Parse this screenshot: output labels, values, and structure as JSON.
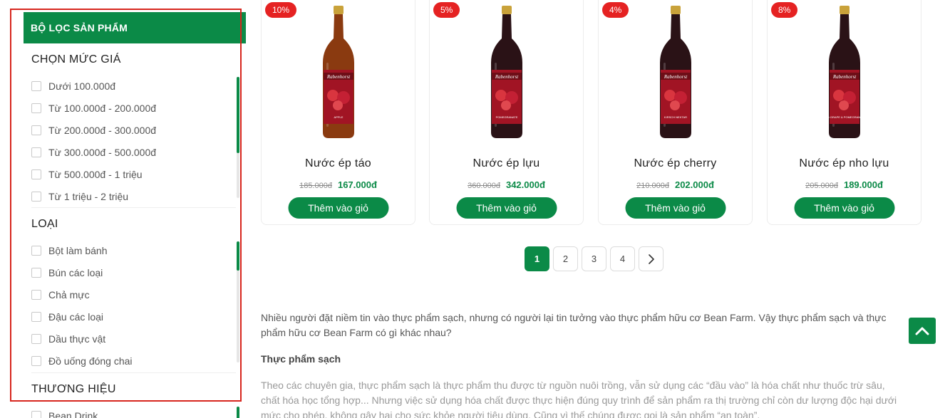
{
  "sidebar": {
    "header": "BỘ LỌC SẢN PHẨM",
    "price_group": {
      "title": "CHỌN MỨC GIÁ",
      "items": [
        "Dưới 100.000đ",
        "Từ 100.000đ - 200.000đ",
        "Từ 200.000đ - 300.000đ",
        "Từ 300.000đ - 500.000đ",
        "Từ 500.000đ - 1 triệu",
        "Từ 1 triệu - 2 triệu"
      ]
    },
    "type_group": {
      "title": "LOẠI",
      "items": [
        "Bột làm bánh",
        "Bún các loại",
        "Chả mực",
        "Đậu các loại",
        "Dầu thực vật",
        "Đồ uống đóng chai"
      ]
    },
    "brand_group": {
      "title": "THƯƠNG HIỆU",
      "items": [
        "Bean Drink"
      ]
    }
  },
  "products": [
    {
      "name": "Nước ép táo",
      "discount": "10%",
      "old_price": "185.000đ",
      "new_price": "167.000đ",
      "cta": "Thêm vào giỏ",
      "label": "Rabenhorst",
      "variant": "APPLE",
      "bottle_color": "#8a3a10"
    },
    {
      "name": "Nước ép lựu",
      "discount": "5%",
      "old_price": "360.000đ",
      "new_price": "342.000đ",
      "cta": "Thêm vào giỏ",
      "label": "Rabenhorst",
      "variant": "POMEGRANATE",
      "bottle_color": "#2a1216"
    },
    {
      "name": "Nước ép cherry",
      "discount": "4%",
      "old_price": "210.000đ",
      "new_price": "202.000đ",
      "cta": "Thêm vào giỏ",
      "label": "Rabenhorst",
      "variant": "KIRSCH NEKTAR",
      "bottle_color": "#2a1216"
    },
    {
      "name": "Nước ép nho lựu",
      "discount": "8%",
      "old_price": "205.000đ",
      "new_price": "189.000đ",
      "cta": "Thêm vào giỏ",
      "label": "Rabenhorst",
      "variant": "RED GRAPE & POMEGRANATE",
      "bottle_color": "#2a1216"
    }
  ],
  "pagination": {
    "pages": [
      "1",
      "2",
      "3",
      "4"
    ],
    "current": "1",
    "next_icon": "chevron-right-icon"
  },
  "description": {
    "intro": "Nhiều người đặt niềm tin vào thực phẩm sạch, nhưng có người lại tin tưởng vào thực phẩm hữu cơ Bean Farm. Vậy thực phẩm sạch và thực phẩm hữu cơ Bean Farm có gì khác nhau?",
    "heading": "Thực phẩm sạch",
    "body": "Theo các chuyên gia, thực phẩm sạch là thực phẩm thu được từ nguồn nuôi trồng, vẫn sử dụng các “đầu vào” là hóa chất như thuốc trừ sâu, chất hóa học tổng hợp... Nhưng việc sử dụng hóa chất được thực hiện đúng quy trình để sản phẩm ra thị trường chỉ còn dư lượng độc hại dưới mức cho phép, không gây hại cho sức khỏe người tiêu dùng. Cũng vì thế chúng được gọi là sản phẩm “an toàn”."
  },
  "colors": {
    "brand": "#0b8a47",
    "sale": "#e52222",
    "highlight": "#d7261e"
  },
  "back_to_top_icon": "chevron-up-icon"
}
